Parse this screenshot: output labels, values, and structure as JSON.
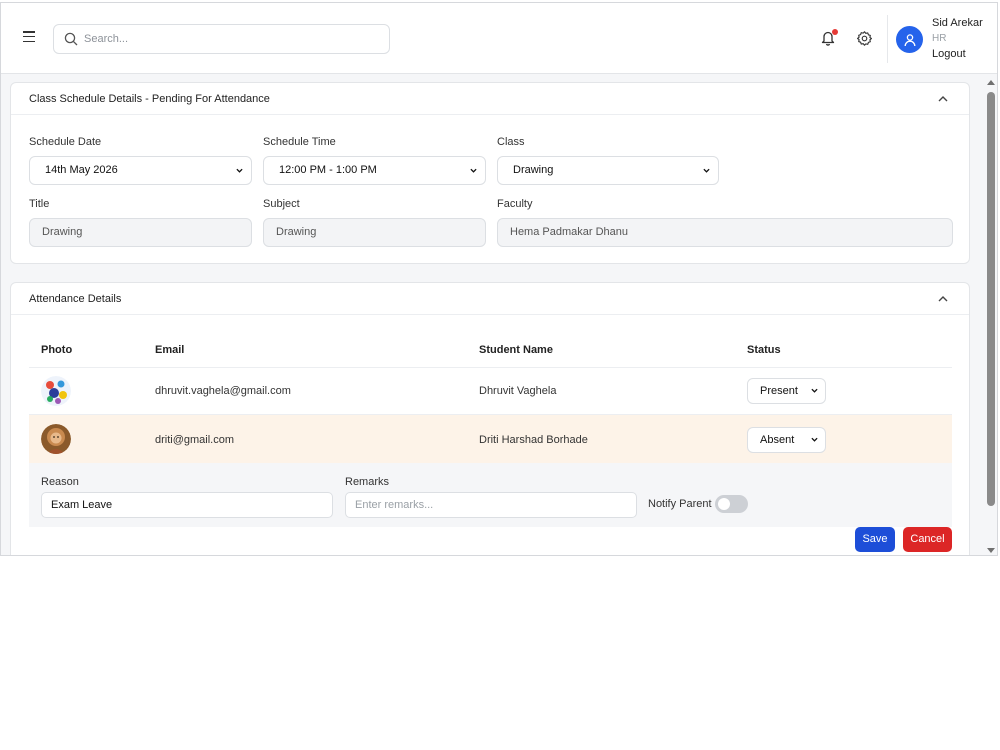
{
  "header": {
    "search_placeholder": "Search...",
    "user": {
      "name": "Sid Arekar",
      "role": "HR",
      "logout_label": "Logout"
    },
    "notification_dot_color": "#e53935",
    "avatar_color": "#2563eb"
  },
  "schedule": {
    "title": "Class Schedule Details - Pending For Attendance",
    "fields": {
      "schedule_date": {
        "label": "Schedule Date",
        "value": "14th May 2026"
      },
      "schedule_time": {
        "label": "Schedule Time",
        "value": "12:00 PM - 1:00 PM"
      },
      "class": {
        "label": "Class",
        "value": "Drawing"
      },
      "title": {
        "label": "Title",
        "value": "Drawing"
      },
      "subject": {
        "label": "Subject",
        "value": "Drawing"
      },
      "faculty": {
        "label": "Faculty",
        "value": "Hema Padmakar Dhanu"
      }
    }
  },
  "attendance": {
    "title": "Attendance Details",
    "columns": {
      "photo": "Photo",
      "email": "Email",
      "student_name": "Student Name",
      "status": "Status"
    },
    "rows": [
      {
        "email": "dhruvit.vaghela@gmail.com",
        "student_name": "Dhruvit Vaghela",
        "status": "Present",
        "photo_icon": "student-photo-icon"
      },
      {
        "email": "driti@gmail.com",
        "student_name": "Driti Harshad Borhade",
        "status": "Absent",
        "photo_icon": "student-photo-icon"
      }
    ],
    "absence": {
      "reason_label": "Reason",
      "reason_value": "Exam Leave",
      "remarks_label": "Remarks",
      "remarks_placeholder": "Enter remarks...",
      "notify_parent_label": "Notify Parent"
    },
    "save_label": "Save",
    "cancel_label": "Cancel",
    "save_color": "#1d4ed8",
    "cancel_color": "#dc2626",
    "absent_row_highlight": "#fdf3e8"
  }
}
